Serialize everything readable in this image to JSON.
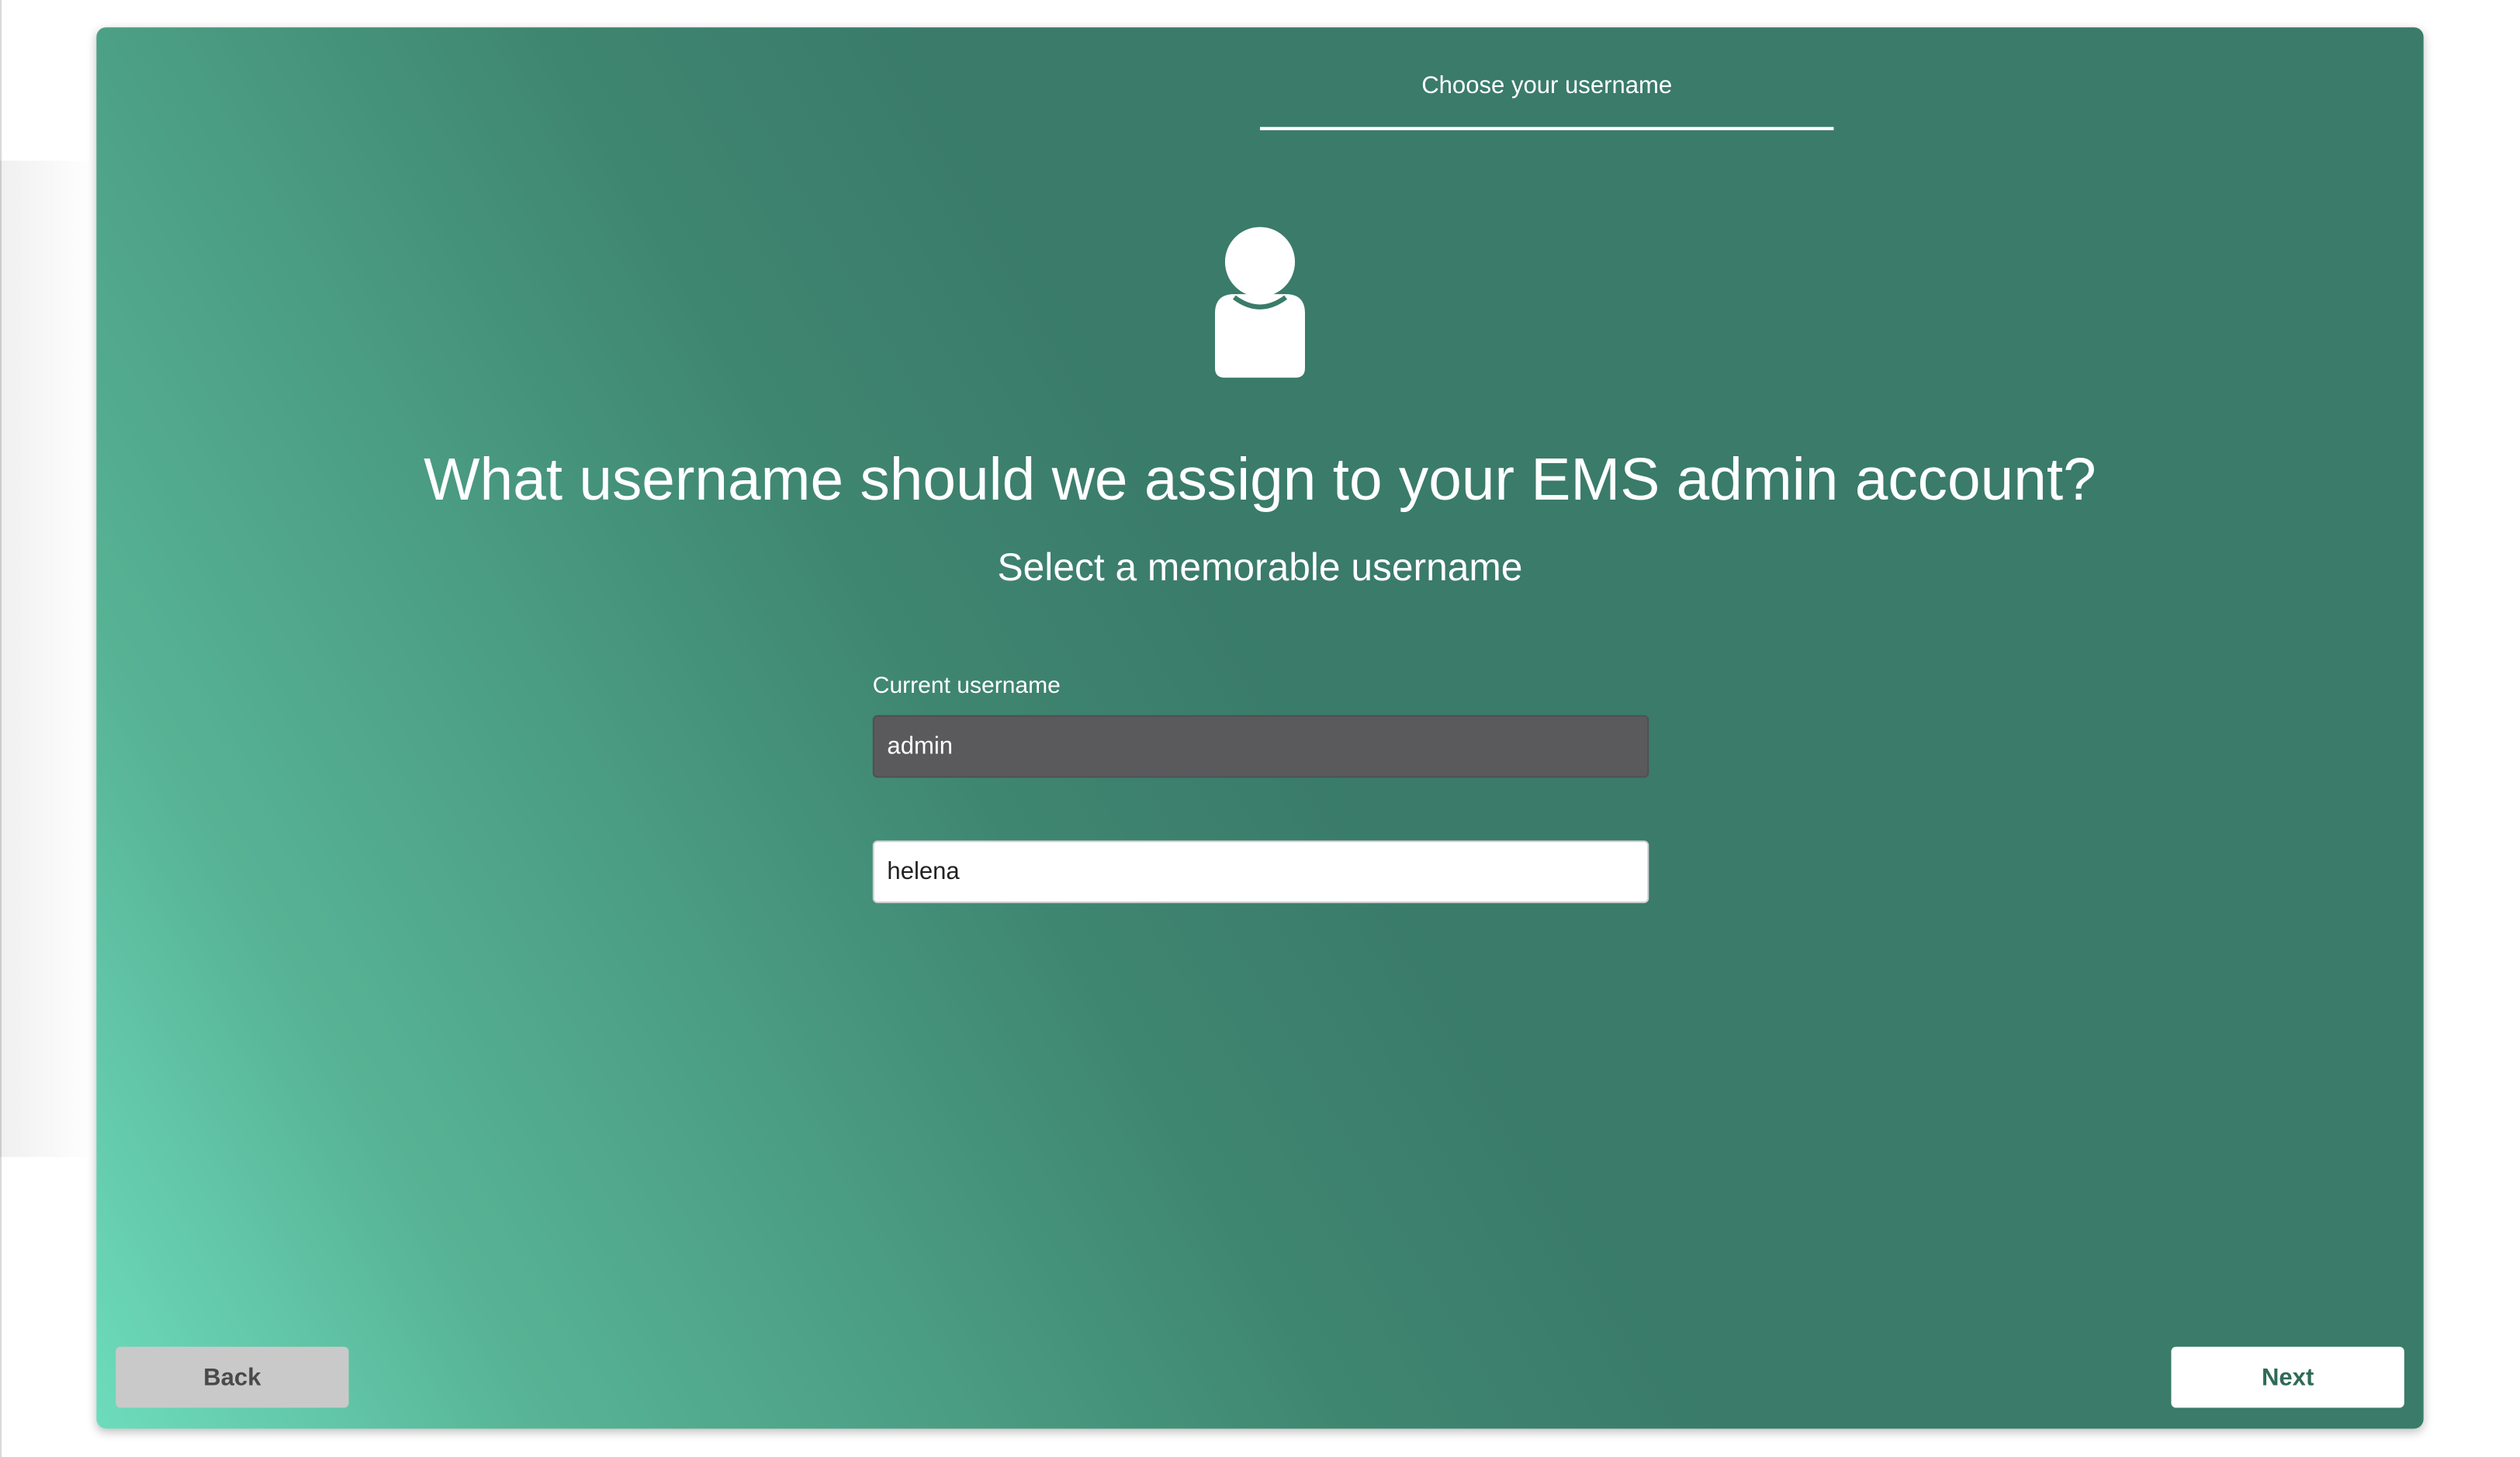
{
  "wizard": {
    "step_title": "Choose your username"
  },
  "content": {
    "icon": "user-icon",
    "headline": "What username should we assign to your EMS admin account?",
    "subheadline": "Select a memorable username",
    "current_username_label": "Current username",
    "current_username_value": "admin",
    "new_username_value": "helena"
  },
  "buttons": {
    "back_label": "Back",
    "next_label": "Next"
  },
  "colors": {
    "gradient_light": "#6ddcbc",
    "background_dark": "#3a7b6a",
    "current_field_bg": "#5a5a5c",
    "back_button_bg": "#c9c9c9",
    "next_text": "#2f6a58"
  }
}
